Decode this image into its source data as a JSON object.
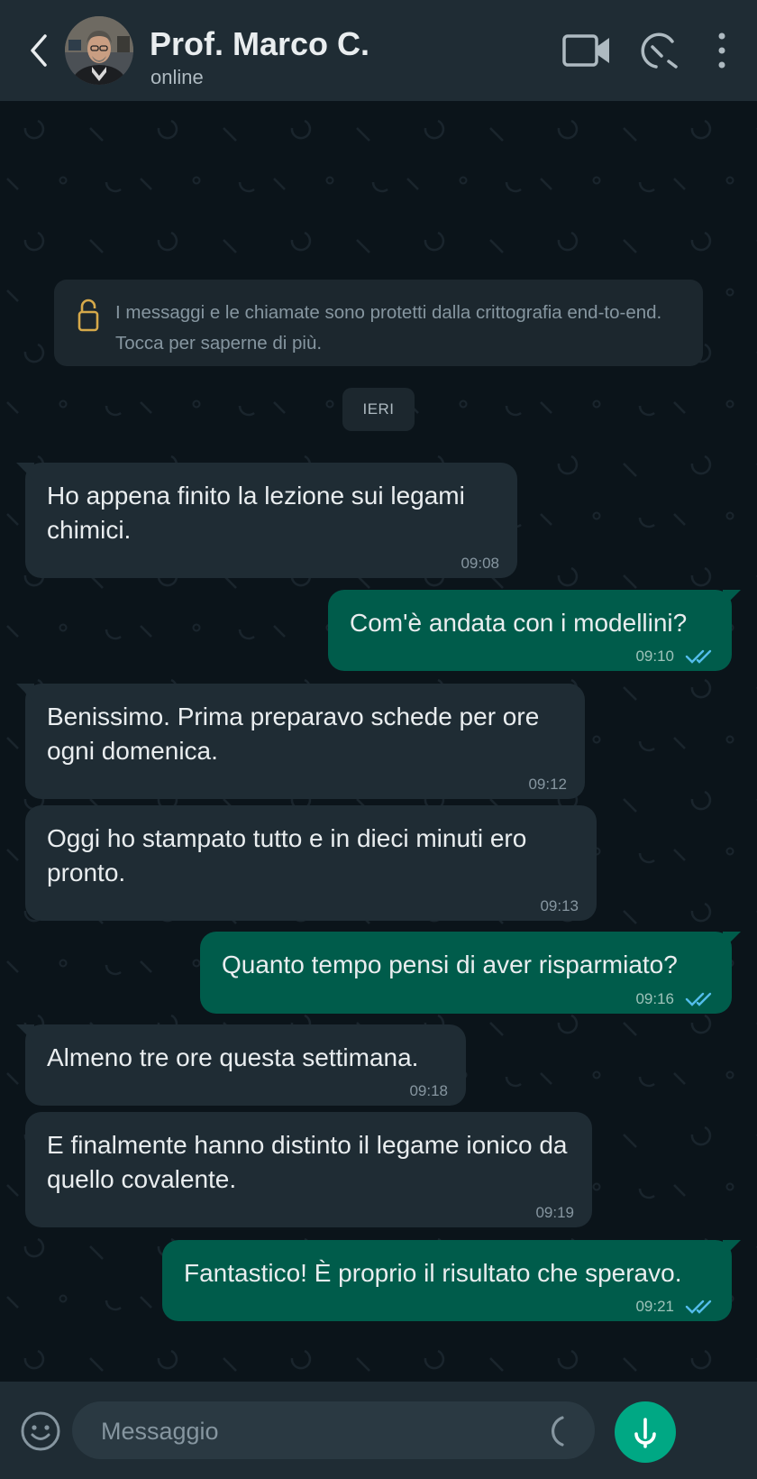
{
  "header": {
    "contact_name": "Prof. Marco C.",
    "status": "online",
    "icons": [
      "back-icon",
      "video-call-icon",
      "voice-call-icon",
      "more-options-icon"
    ]
  },
  "chat": {
    "encryption_notice": "I messaggi e le chiamate sono protetti dalla crittografia end-to-end. Tocca per saperne di più.",
    "date_label": "IERI",
    "messages": [
      {
        "direction": "in",
        "text": "Ho appena finito la lezione sui legami chimici.",
        "time": "09:08"
      },
      {
        "direction": "out",
        "text": "Com'è andata con i modellini?",
        "time": "09:10",
        "read": true
      },
      {
        "direction": "in",
        "text": "Benissimo. Prima preparavo schede per ore ogni domenica.",
        "time": "09:12"
      },
      {
        "direction": "in",
        "text": "Oggi ho stampato tutto e in dieci minuti ero pronto.",
        "time": "09:13"
      },
      {
        "direction": "out",
        "text": "Quanto tempo pensi di aver risparmiato?",
        "time": "09:16",
        "read": true
      },
      {
        "direction": "in",
        "text": "Almeno tre ore questa settimana.",
        "time": "09:18"
      },
      {
        "direction": "in",
        "text": "E finalmente hanno distinto il legame ionico da quello covalente.",
        "time": "09:19"
      },
      {
        "direction": "out",
        "text": "Fantastico! È proprio il risultato che speravo.",
        "time": "09:21",
        "read": true
      }
    ]
  },
  "input": {
    "placeholder": "Messaggio",
    "value": ""
  },
  "colors": {
    "background": "#0b141a",
    "header": "#1f2c34",
    "incoming_bubble": "#1f2c34",
    "outgoing_bubble": "#005c4b",
    "accent": "#00a884",
    "read_ticks": "#53bdeb",
    "lock": "#d6a94a"
  }
}
